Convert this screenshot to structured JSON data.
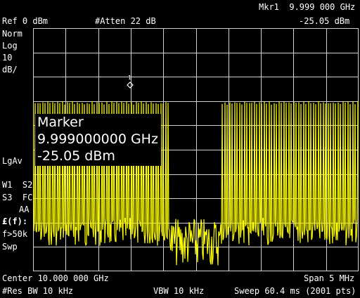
{
  "header": {
    "marker_readout": "Mkr1  9.999 000 GHz",
    "ref_level": "Ref 0 dBm",
    "atten": "#Atten 22 dB",
    "marker_level": "-25.05 dBm"
  },
  "left_annotations": {
    "det": "Norm",
    "scale": "Log",
    "scale_value": "10",
    "scale_unit": "dB/",
    "avg": "LgAv",
    "w1s2": "W1  S2",
    "s3fc": "S3  FC",
    "aa": "AA",
    "ff": "£(f):",
    "f50k": "f>50k",
    "swp": "Swp"
  },
  "marker_box": {
    "title": "Marker",
    "frequency": "9.999000000 GHz",
    "amplitude": "-25.05 dBm",
    "marker_number": "1"
  },
  "footer": {
    "center": "Center 10.000 000 GHz",
    "span": "Span 5 MHz",
    "res_bw": "#Res BW 10 kHz",
    "vbw": "VBW 10 kHz",
    "sweep": "Sweep 60.4 ms (2001 pts)"
  },
  "colors": {
    "trace": "#ffff00",
    "grid": "#cfcfcf",
    "background": "#000000",
    "text": "#ffffff"
  }
}
